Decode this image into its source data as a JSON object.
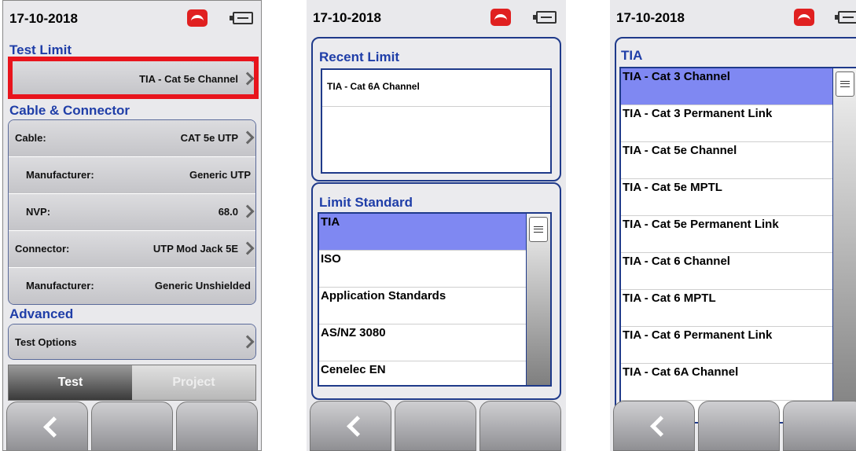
{
  "screen1": {
    "date": "17-10-2018",
    "test_limit_title": "Test Limit",
    "test_limit_value": "TIA - Cat 5e Channel",
    "cable_section_title": "Cable & Connector",
    "cable_rows": [
      {
        "label": "Cable:",
        "value": "CAT 5e UTP"
      },
      {
        "label": "Manufacturer:",
        "value": "Generic UTP"
      },
      {
        "label": "NVP:",
        "value": "68.0"
      },
      {
        "label": "Connector:",
        "value": "UTP Mod Jack 5E"
      },
      {
        "label": "Manufacturer:",
        "value": "Generic Unshielded"
      }
    ],
    "advanced_title": "Advanced",
    "test_options_label": "Test Options",
    "tabs": {
      "test": "Test",
      "project": "Project"
    }
  },
  "screen2": {
    "date": "17-10-2018",
    "recent_title": "Recent Limit",
    "recent_items": [
      "TIA - Cat 6A Channel"
    ],
    "standard_title": "Limit Standard",
    "standards": [
      "TIA",
      "ISO",
      "Application Standards",
      "AS/NZ 3080",
      "Cenelec EN"
    ]
  },
  "screen3": {
    "date": "17-10-2018",
    "title": "TIA",
    "limits": [
      "TIA - Cat 3 Channel",
      "TIA - Cat 3 Permanent Link",
      "TIA - Cat 5e Channel",
      "TIA - Cat 5e MPTL",
      "TIA - Cat 5e Permanent Link",
      "TIA - Cat 6 Channel",
      "TIA - Cat 6 MPTL",
      "TIA - Cat 6 Permanent Link",
      "TIA - Cat 6A Channel"
    ]
  },
  "colors": {
    "accent_blue": "#1f3ea8",
    "selection": "#7f88f2",
    "highlight_red": "#e8141c",
    "phone_red": "#e02020"
  },
  "icons": [
    "phone-hangup-icon",
    "battery-icon",
    "chevron-right-icon",
    "back-arrow-icon",
    "scroll-thumb-icon"
  ]
}
